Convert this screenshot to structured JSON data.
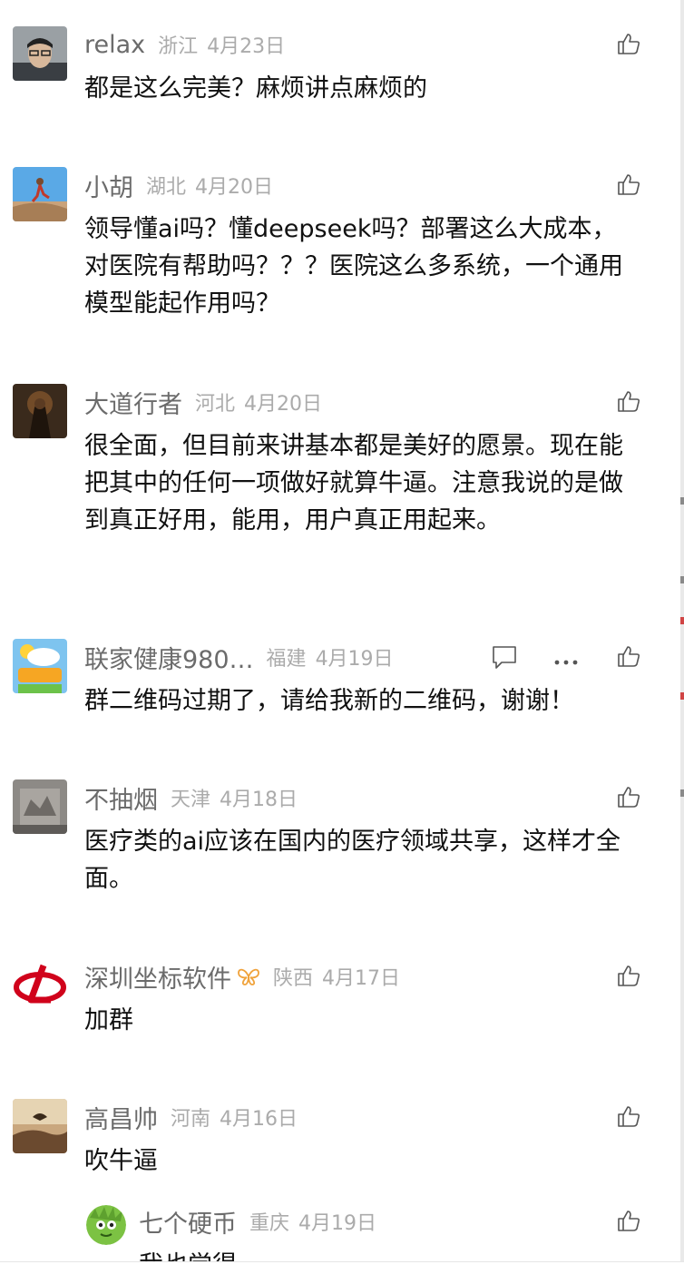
{
  "comments": [
    {
      "name": "relax",
      "location": "浙江",
      "date": "4月23日",
      "text": "都是这么完美？麻烦讲点麻烦的"
    },
    {
      "name": "小胡",
      "location": "湖北",
      "date": "4月20日",
      "text": "领导懂ai吗？懂deepseek吗？部署这么大成本，对医院有帮助吗？？？医院这么多系统，一个通用模型能起作用吗？"
    },
    {
      "name": "大道行者",
      "location": "河北",
      "date": "4月20日",
      "text": "很全面，但目前来讲基本都是美好的愿景。现在能把其中的任何一项做好就算牛逼。注意我说的是做到真正好用，能用，用户真正用起来。"
    },
    {
      "name": "联家健康980…",
      "location": "福建",
      "date": "4月19日",
      "text": "群二维码过期了，请给我新的二维码，谢谢！"
    },
    {
      "name": "不抽烟",
      "location": "天津",
      "date": "4月18日",
      "text": "医疗类的ai应该在国内的医疗领域共享，这样才全面。"
    },
    {
      "name": "深圳坐标软件",
      "location": "陕西",
      "date": "4月17日",
      "text": "加群"
    },
    {
      "name": "高昌帅",
      "location": "河南",
      "date": "4月16日",
      "text": "吹牛逼"
    }
  ],
  "reply": {
    "name": "七个硬币",
    "location": "重庆",
    "date": "4月19日",
    "text": "我也觉得"
  },
  "colors": {
    "name": "#6b6b6b",
    "meta": "#ababab",
    "text": "#111111",
    "badge": "#f0a23a"
  }
}
